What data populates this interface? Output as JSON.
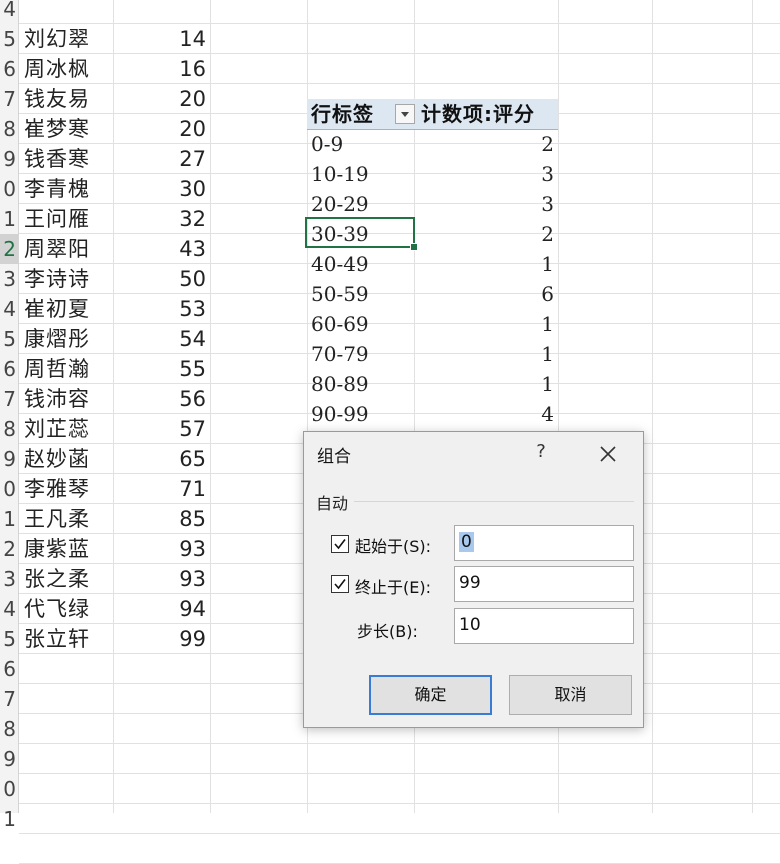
{
  "row_headers": [
    "4",
    "5",
    "6",
    "7",
    "8",
    "9",
    "0",
    "1",
    "2",
    "3",
    "4",
    "5",
    "6",
    "7",
    "8",
    "9",
    "0",
    "1",
    "2",
    "3",
    "4",
    "5",
    "6",
    "7",
    "8",
    "9",
    "0",
    "1"
  ],
  "selected_row_index": 8,
  "data_rows": [
    {
      "name": "刘幻翠",
      "score": "14"
    },
    {
      "name": "周冰枫",
      "score": "16"
    },
    {
      "name": "钱友易",
      "score": "20"
    },
    {
      "name": "崔梦寒",
      "score": "20"
    },
    {
      "name": "钱香寒",
      "score": "27"
    },
    {
      "name": "李青槐",
      "score": "30"
    },
    {
      "name": "王问雁",
      "score": "32"
    },
    {
      "name": "周翠阳",
      "score": "43"
    },
    {
      "name": "李诗诗",
      "score": "50"
    },
    {
      "name": "崔初夏",
      "score": "53"
    },
    {
      "name": "康熠彤",
      "score": "54"
    },
    {
      "name": "周哲瀚",
      "score": "55"
    },
    {
      "name": "钱沛容",
      "score": "56"
    },
    {
      "name": "刘芷蕊",
      "score": "57"
    },
    {
      "name": "赵妙菡",
      "score": "65"
    },
    {
      "name": "李雅琴",
      "score": "71"
    },
    {
      "name": "王凡柔",
      "score": "85"
    },
    {
      "name": "康紫蓝",
      "score": "93"
    },
    {
      "name": "张之柔",
      "score": "93"
    },
    {
      "name": "代飞绿",
      "score": "94"
    },
    {
      "name": "张立轩",
      "score": "99"
    }
  ],
  "pivot": {
    "row_label_header": "行标签",
    "value_header": "计数项:评分",
    "rows": [
      {
        "label": "0-9",
        "count": "2"
      },
      {
        "label": "10-19",
        "count": "3"
      },
      {
        "label": "20-29",
        "count": "3"
      },
      {
        "label": "30-39",
        "count": "2"
      },
      {
        "label": "40-49",
        "count": "1"
      },
      {
        "label": "50-59",
        "count": "6"
      },
      {
        "label": "60-69",
        "count": "1"
      },
      {
        "label": "70-79",
        "count": "1"
      },
      {
        "label": "80-89",
        "count": "1"
      },
      {
        "label": "90-99",
        "count": "4"
      }
    ]
  },
  "dialog": {
    "title": "组合",
    "help": "?",
    "group_label": "自动",
    "start_label": "起始于(S):",
    "start_value": "0",
    "start_checked": true,
    "end_label": "终止于(E):",
    "end_value": "99",
    "end_checked": true,
    "step_label": "步长(B):",
    "step_value": "10",
    "ok_label": "确定",
    "cancel_label": "取消"
  },
  "colors": {
    "accent_green": "#217346",
    "pivot_header_bg": "#dde7f2",
    "focus_blue": "#3a7bd5"
  }
}
